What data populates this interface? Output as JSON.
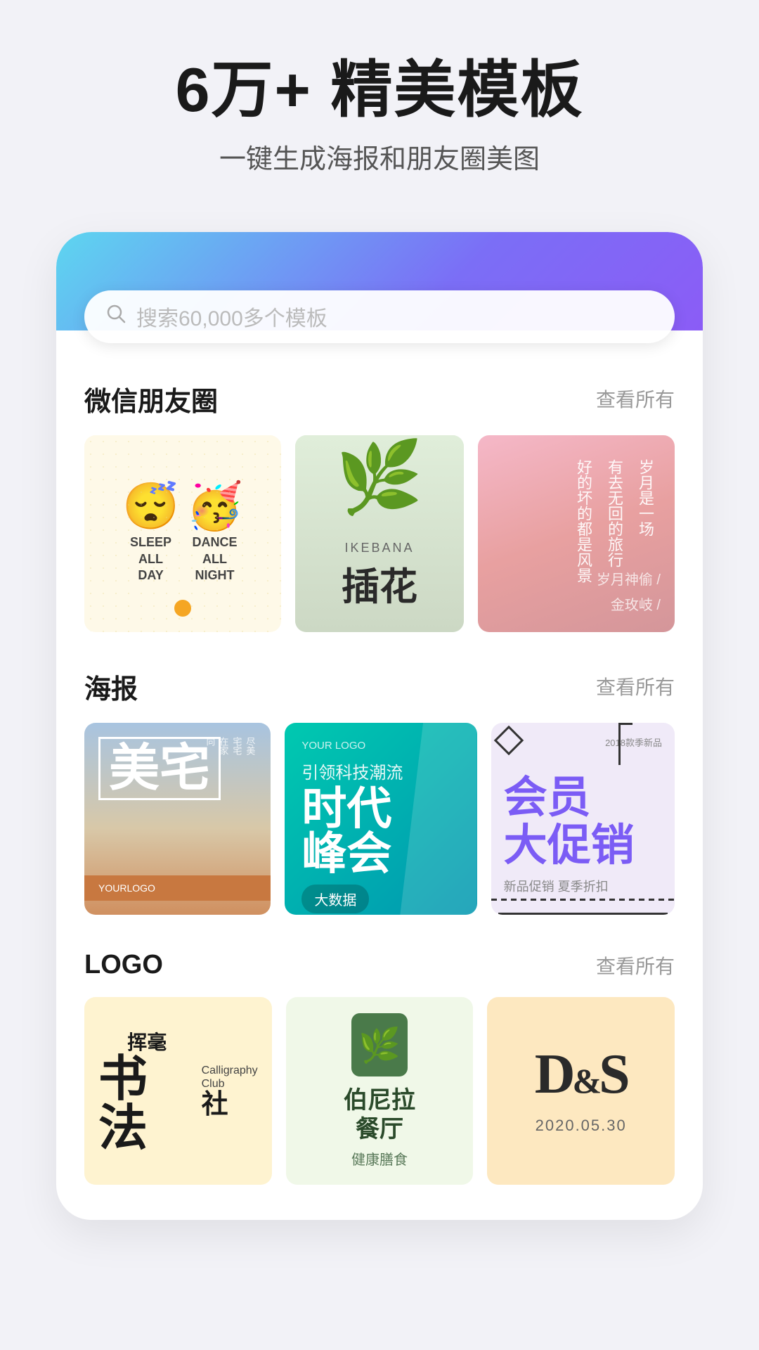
{
  "hero": {
    "title": "6万+ 精美模板",
    "subtitle": "一键生成海报和朋友圈美图"
  },
  "search": {
    "placeholder": "搜索60,000多个模板"
  },
  "sections": {
    "wechat": {
      "title": "微信朋友圈",
      "link": "查看所有"
    },
    "poster": {
      "title": "海报",
      "link": "查看所有"
    },
    "logo": {
      "title": "LOGO",
      "link": "查看所有"
    }
  },
  "wechat_cards": [
    {
      "type": "sleep-dance",
      "text1_line1": "SLEEP",
      "text1_line2": "ALL",
      "text1_line3": "DAY",
      "text2_line1": "DANCE",
      "text2_line2": "ALL",
      "text2_line3": "NIGHT"
    },
    {
      "type": "ikebana",
      "en": "IKEBANA",
      "cn": "插花"
    },
    {
      "type": "poem",
      "line1": "岁月是一场",
      "line2": "有去无回的旅行",
      "line3": "好的坏的都是风景",
      "author": "岁月神偷 /",
      "author2": "金玫岐 /"
    }
  ],
  "poster_cards": [
    {
      "title": "美宅",
      "side_text": "尽美宅在家向",
      "bottom": "YOURLOGO"
    },
    {
      "logo": "YOUR LOGO",
      "main1": "时代",
      "main2": "峰会",
      "sub": "大数据",
      "detail": "引领科技潮流",
      "btn": "大数据"
    },
    {
      "badge": "2018款季新品",
      "title": "会员",
      "title2": "大促销",
      "sub": "新品促销 夏季折扣"
    }
  ],
  "logo_cards": [
    {
      "cn1": "挥毫",
      "cn2": "书法",
      "en1": "Calligraphy",
      "en2": "Club",
      "cn3": "社"
    },
    {
      "name": "伯尼拉",
      "name2": "餐厅",
      "sub": "健康膳食"
    },
    {
      "letter1": "D",
      "letter2": "S",
      "date": "2020.05.30"
    }
  ],
  "icons": {
    "search": "🔍"
  }
}
